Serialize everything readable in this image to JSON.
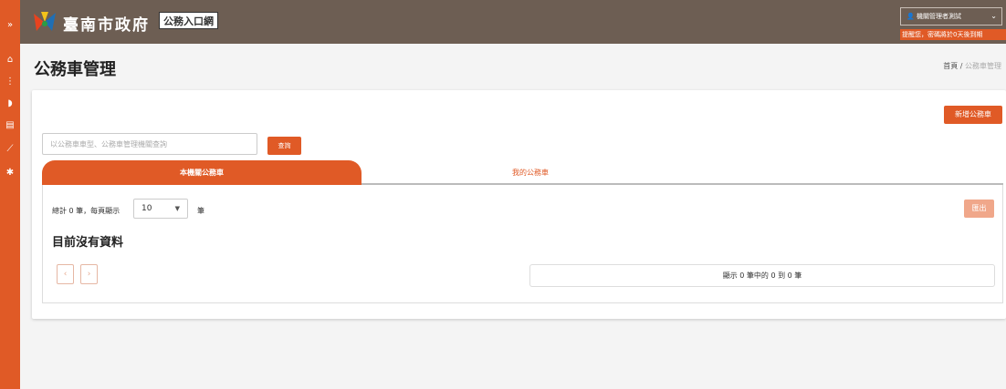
{
  "colors": {
    "accent": "#e05a26",
    "header_bg": "#6d5e53",
    "page_bg": "#f4f4f4"
  },
  "rail": {
    "icons": [
      "chevrons-icon",
      "home-icon",
      "grid-icon",
      "shield-icon",
      "id-card-icon",
      "wrench-icon",
      "gear-icon"
    ]
  },
  "header": {
    "site_name": "臺南市政府",
    "portal_badge": "公務入口網",
    "user_label": "機關管理者測試",
    "notice": "提醒您，密碼將於0天後到期"
  },
  "page": {
    "title": "公務車管理",
    "breadcrumb": {
      "home": "首頁",
      "separator": "/",
      "current": "公務車管理"
    }
  },
  "toolbar": {
    "add_label": "新增公務車",
    "search_placeholder": "以公務車車型、公務車管理機關查詢",
    "query_label": "查詢"
  },
  "tabs": [
    {
      "label": "本機關公務車",
      "active": true
    },
    {
      "label": "我的公務車",
      "active": false
    }
  ],
  "table": {
    "count_text": "總計 0 筆，每頁顯示",
    "page_size": "10",
    "unit_text": "筆",
    "export_label": "匯出",
    "empty_text": "目前沒有資料",
    "info_text": "顯示 0 筆中的 0 到 0 筆",
    "prev_label": "‹",
    "next_label": "›"
  }
}
